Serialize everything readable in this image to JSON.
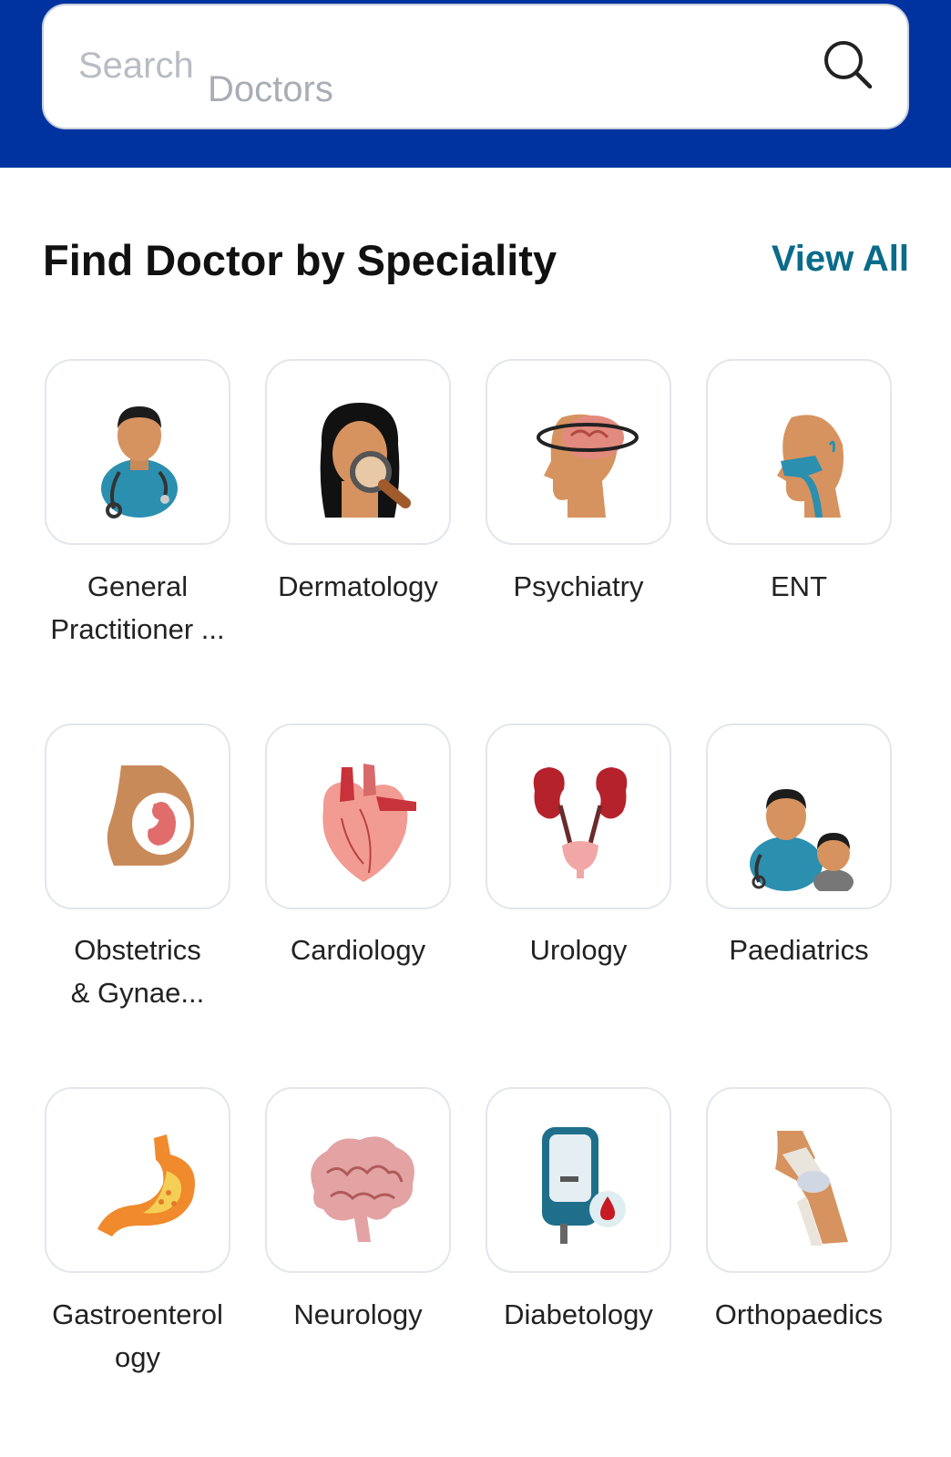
{
  "search": {
    "placeholder_line1": "Search",
    "placeholder_line2": "Doctors",
    "icon": "search-icon"
  },
  "section": {
    "title": "Find Doctor by Speciality",
    "view_all": "View All"
  },
  "specialities": [
    {
      "label_line1": "General",
      "label_line2": "Practitioner ...",
      "icon": "general-practitioner-icon"
    },
    {
      "label_line1": "Dermatology",
      "label_line2": "",
      "icon": "dermatology-icon"
    },
    {
      "label_line1": "Psychiatry",
      "label_line2": "",
      "icon": "psychiatry-icon"
    },
    {
      "label_line1": "ENT",
      "label_line2": "",
      "icon": "ent-icon"
    },
    {
      "label_line1": "Obstetrics",
      "label_line2": "& Gynae...",
      "icon": "obstetrics-icon"
    },
    {
      "label_line1": "Cardiology",
      "label_line2": "",
      "icon": "heart-icon"
    },
    {
      "label_line1": "Urology",
      "label_line2": "",
      "icon": "kidney-icon"
    },
    {
      "label_line1": "Paediatrics",
      "label_line2": "",
      "icon": "paediatrics-icon"
    },
    {
      "label_line1": "Gastroenterol",
      "label_line2": "ogy",
      "icon": "stomach-icon"
    },
    {
      "label_line1": "Neurology",
      "label_line2": "",
      "icon": "brain-icon"
    },
    {
      "label_line1": "Diabetology",
      "label_line2": "",
      "icon": "glucometer-icon"
    },
    {
      "label_line1": "Orthopaedics",
      "label_line2": "",
      "icon": "knee-joint-icon"
    }
  ],
  "colors": {
    "header_blue": "#0033a0",
    "link_teal": "#0a6b8a",
    "tile_border": "#e3e6ea"
  }
}
